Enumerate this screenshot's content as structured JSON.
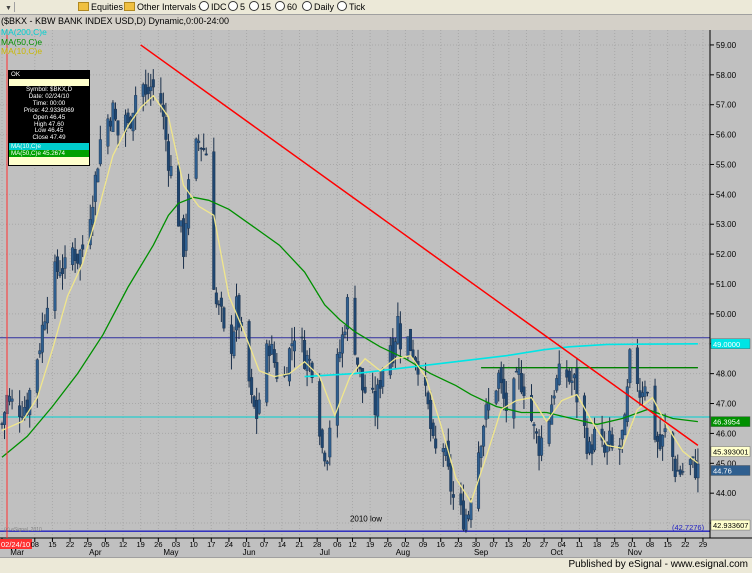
{
  "toolbar": {
    "items": [
      {
        "label": "Equities",
        "icon": "folder-icon"
      },
      {
        "label": "Other Intervals",
        "icon": "folder-icon"
      },
      {
        "label": "IDC",
        "icon": "clock-icon"
      },
      {
        "label": "5",
        "icon": "clock-icon"
      },
      {
        "label": "15",
        "icon": "clock-icon"
      },
      {
        "label": "60",
        "icon": "clock-icon"
      },
      {
        "label": "Daily",
        "icon": "clock-icon"
      },
      {
        "label": "Tick",
        "icon": "clock-icon"
      }
    ]
  },
  "symbol_line": "($BKX - KBW BANK INDEX USD,D) Dynamic,0:00-24:00",
  "ma_labels": {
    "ma200": "MA(200,C)e",
    "ma50": "MA(50,C)e",
    "ma10": "MA(10,C)e"
  },
  "databox": {
    "header": "OK",
    "rows": [
      "Symbol: $BKX,D",
      "Date: 02/24/10",
      "Time: 00:00",
      "Price: 42.9336069",
      "Open 46.45",
      "High 47.60",
      "Low 46.45",
      "Close 47.49"
    ],
    "ma10": "MA(10,C)e",
    "ma50": "MA(50,C)e 45.2674"
  },
  "watermark": "(c) eSignal, 2010",
  "annotation_low": "2010 low",
  "status": "Published by eSignal - www.esignal.com",
  "colors": {
    "background": "#c0c0c0",
    "candle": "#2f5f8f",
    "ma10": "#f0e68c",
    "ma50": "#009000",
    "ma200": "#00e5e5",
    "trendline": "#ff0000",
    "hline_low": "#2020c0",
    "hline_upper": "#3030a0",
    "hline_cyan": "#00d0d0",
    "resistance": "#008000",
    "cursor": "#ff3030"
  },
  "chart_data": {
    "type": "candlestick",
    "ylim": [
      42.5,
      59.5
    ],
    "y_ticks": [
      "59.00",
      "58.00",
      "57.00",
      "56.00",
      "55.00",
      "54.00",
      "53.00",
      "52.00",
      "51.00",
      "50.00",
      "49.00",
      "48.00",
      "47.00",
      "46.00",
      "45.00",
      "44.00",
      "43.00"
    ],
    "x_ticks": [
      {
        "label": "02/24/10",
        "day": 0
      },
      {
        "label": "08",
        "day": 13
      },
      {
        "label": "15",
        "day": 20
      },
      {
        "label": "22",
        "day": 27
      },
      {
        "label": "29",
        "day": 34
      },
      {
        "label": "05",
        "day": 41
      },
      {
        "label": "12",
        "day": 48
      },
      {
        "label": "19",
        "day": 55
      },
      {
        "label": "26",
        "day": 62
      },
      {
        "label": "03",
        "day": 69
      },
      {
        "label": "10",
        "day": 76
      },
      {
        "label": "17",
        "day": 83
      },
      {
        "label": "24",
        "day": 90
      },
      {
        "label": "01",
        "day": 97
      },
      {
        "label": "07",
        "day": 104
      },
      {
        "label": "14",
        "day": 111
      },
      {
        "label": "21",
        "day": 118
      },
      {
        "label": "28",
        "day": 125
      },
      {
        "label": "06",
        "day": 133
      },
      {
        "label": "12",
        "day": 139
      },
      {
        "label": "19",
        "day": 146
      },
      {
        "label": "26",
        "day": 153
      },
      {
        "label": "02",
        "day": 160
      },
      {
        "label": "09",
        "day": 167
      },
      {
        "label": "16",
        "day": 174
      },
      {
        "label": "23",
        "day": 181
      },
      {
        "label": "30",
        "day": 188
      },
      {
        "label": "07",
        "day": 195
      },
      {
        "label": "13",
        "day": 201
      },
      {
        "label": "20",
        "day": 208
      },
      {
        "label": "27",
        "day": 215
      },
      {
        "label": "04",
        "day": 222
      },
      {
        "label": "11",
        "day": 229
      },
      {
        "label": "18",
        "day": 236
      },
      {
        "label": "25",
        "day": 243
      },
      {
        "label": "01",
        "day": 250
      },
      {
        "label": "08",
        "day": 257
      },
      {
        "label": "15",
        "day": 264
      },
      {
        "label": "22",
        "day": 271
      },
      {
        "label": "29",
        "day": 278
      }
    ],
    "month_labels": [
      {
        "label": "Mar",
        "day": 6
      },
      {
        "label": "Apr",
        "day": 37
      },
      {
        "label": "May",
        "day": 67
      },
      {
        "label": "Jun",
        "day": 98
      },
      {
        "label": "Jul",
        "day": 128
      },
      {
        "label": "Aug",
        "day": 159
      },
      {
        "label": "Sep",
        "day": 190
      },
      {
        "label": "Oct",
        "day": 220
      },
      {
        "label": "Nov",
        "day": 251
      }
    ],
    "day_range": [
      0,
      280
    ],
    "close_path": [
      [
        0,
        46.3
      ],
      [
        2,
        47.2
      ],
      [
        6,
        46.8
      ],
      [
        10,
        47.0
      ],
      [
        13,
        48.2
      ],
      [
        15,
        49.0
      ],
      [
        18,
        50.6
      ],
      [
        20,
        51.2
      ],
      [
        23,
        51.6
      ],
      [
        25,
        51.5
      ],
      [
        27,
        52.3
      ],
      [
        30,
        51.9
      ],
      [
        32,
        52.2
      ],
      [
        34,
        53.0
      ],
      [
        37,
        54.5
      ],
      [
        39,
        55.8
      ],
      [
        41,
        56.4
      ],
      [
        44,
        56.8
      ],
      [
        46,
        56.0
      ],
      [
        48,
        57.2
      ],
      [
        50,
        56.2
      ],
      [
        52,
        57.0
      ],
      [
        55,
        58.1
      ],
      [
        57,
        57.2
      ],
      [
        59,
        57.6
      ],
      [
        61,
        57.5
      ],
      [
        63,
        57.1
      ],
      [
        66,
        55.2
      ],
      [
        68,
        54.4
      ],
      [
        70,
        53.2
      ],
      [
        72,
        52.2
      ],
      [
        74,
        54.2
      ],
      [
        76,
        55.2
      ],
      [
        78,
        55.8
      ],
      [
        81,
        55.4
      ],
      [
        83,
        52.0
      ],
      [
        85,
        50.3
      ],
      [
        87,
        49.9
      ],
      [
        89,
        48.6
      ],
      [
        91,
        49.0
      ],
      [
        93,
        50.2
      ],
      [
        95,
        49.3
      ],
      [
        97,
        48.4
      ],
      [
        99,
        47.0
      ],
      [
        101,
        46.6
      ],
      [
        104,
        48.3
      ],
      [
        106,
        49.0
      ],
      [
        108,
        48.4
      ],
      [
        111,
        47.4
      ],
      [
        113,
        48.4
      ],
      [
        116,
        49.4
      ],
      [
        118,
        49.2
      ],
      [
        120,
        48.6
      ],
      [
        123,
        48.3
      ],
      [
        125,
        47.1
      ],
      [
        127,
        45.5
      ],
      [
        129,
        45.4
      ],
      [
        131,
        47.3
      ],
      [
        133,
        48.3
      ],
      [
        135,
        49.2
      ],
      [
        137,
        50.3
      ],
      [
        139,
        49.6
      ],
      [
        141,
        48.4
      ],
      [
        143,
        47.5
      ],
      [
        146,
        47.3
      ],
      [
        148,
        46.8
      ],
      [
        150,
        47.8
      ],
      [
        153,
        49.3
      ],
      [
        155,
        48.8
      ],
      [
        157,
        49.8
      ],
      [
        159,
        48.5
      ],
      [
        161,
        49.1
      ],
      [
        163,
        48.8
      ],
      [
        165,
        48.4
      ],
      [
        167,
        47.6
      ],
      [
        169,
        46.8
      ],
      [
        171,
        45.5
      ],
      [
        173,
        45.2
      ],
      [
        175,
        45.6
      ],
      [
        177,
        44.6
      ],
      [
        179,
        43.8
      ],
      [
        181,
        43.4
      ],
      [
        183,
        43.2
      ],
      [
        185,
        43.4
      ],
      [
        187,
        44.6
      ],
      [
        189,
        45.5
      ],
      [
        191,
        46.4
      ],
      [
        193,
        46.9
      ],
      [
        195,
        47.4
      ],
      [
        197,
        47.9
      ],
      [
        199,
        47.1
      ],
      [
        201,
        46.6
      ],
      [
        203,
        47.4
      ],
      [
        205,
        47.9
      ],
      [
        207,
        47.6
      ],
      [
        209,
        46.8
      ],
      [
        211,
        46.1
      ],
      [
        213,
        45.6
      ],
      [
        215,
        46.0
      ],
      [
        217,
        46.6
      ],
      [
        219,
        47.5
      ],
      [
        221,
        47.9
      ],
      [
        223,
        48.1
      ],
      [
        225,
        47.8
      ],
      [
        227,
        47.7
      ],
      [
        229,
        46.8
      ],
      [
        231,
        46.1
      ],
      [
        233,
        45.4
      ],
      [
        235,
        45.9
      ],
      [
        237,
        45.6
      ],
      [
        239,
        45.3
      ],
      [
        241,
        45.7
      ],
      [
        243,
        45.1
      ],
      [
        245,
        45.6
      ],
      [
        247,
        46.2
      ],
      [
        249,
        48.4
      ],
      [
        251,
        48.3
      ],
      [
        253,
        47.4
      ],
      [
        255,
        47.8
      ],
      [
        257,
        46.7
      ],
      [
        259,
        46.0
      ],
      [
        261,
        45.5
      ],
      [
        263,
        46.0
      ],
      [
        265,
        45.6
      ],
      [
        267,
        44.8
      ],
      [
        269,
        44.7
      ],
      [
        271,
        44.8
      ],
      [
        273,
        45.0
      ],
      [
        276,
        44.76
      ]
    ],
    "ma10": [
      [
        0,
        46.1
      ],
      [
        8,
        46.4
      ],
      [
        14,
        47.2
      ],
      [
        20,
        48.8
      ],
      [
        26,
        50.6
      ],
      [
        32,
        51.7
      ],
      [
        38,
        53.4
      ],
      [
        44,
        55.3
      ],
      [
        50,
        56.3
      ],
      [
        55,
        56.9
      ],
      [
        60,
        57.3
      ],
      [
        66,
        56.6
      ],
      [
        72,
        54.3
      ],
      [
        78,
        53.6
      ],
      [
        84,
        53.3
      ],
      [
        90,
        50.6
      ],
      [
        96,
        49.4
      ],
      [
        102,
        48.1
      ],
      [
        108,
        47.9
      ],
      [
        114,
        48.0
      ],
      [
        120,
        48.4
      ],
      [
        126,
        47.9
      ],
      [
        132,
        46.6
      ],
      [
        138,
        47.9
      ],
      [
        144,
        48.5
      ],
      [
        150,
        48.1
      ],
      [
        156,
        48.5
      ],
      [
        162,
        48.6
      ],
      [
        168,
        47.9
      ],
      [
        174,
        46.3
      ],
      [
        180,
        44.5
      ],
      [
        186,
        43.7
      ],
      [
        192,
        45.2
      ],
      [
        198,
        46.8
      ],
      [
        204,
        47.1
      ],
      [
        210,
        47.2
      ],
      [
        216,
        46.4
      ],
      [
        222,
        47.1
      ],
      [
        228,
        47.3
      ],
      [
        234,
        46.4
      ],
      [
        240,
        45.6
      ],
      [
        246,
        45.5
      ],
      [
        252,
        46.8
      ],
      [
        258,
        47.2
      ],
      [
        264,
        46.2
      ],
      [
        270,
        45.4
      ],
      [
        276,
        45.0
      ]
    ],
    "ma50": [
      [
        0,
        45.2
      ],
      [
        10,
        45.9
      ],
      [
        20,
        46.9
      ],
      [
        30,
        48.0
      ],
      [
        40,
        49.3
      ],
      [
        50,
        50.9
      ],
      [
        60,
        52.3
      ],
      [
        66,
        53.3
      ],
      [
        70,
        53.7
      ],
      [
        76,
        53.9
      ],
      [
        82,
        53.8
      ],
      [
        90,
        53.5
      ],
      [
        100,
        52.9
      ],
      [
        110,
        52.3
      ],
      [
        120,
        51.4
      ],
      [
        128,
        50.3
      ],
      [
        134,
        49.8
      ],
      [
        140,
        49.4
      ],
      [
        150,
        48.9
      ],
      [
        160,
        48.5
      ],
      [
        170,
        48.0
      ],
      [
        180,
        47.6
      ],
      [
        186,
        47.3
      ],
      [
        196,
        46.9
      ],
      [
        206,
        46.7
      ],
      [
        216,
        46.7
      ],
      [
        226,
        46.5
      ],
      [
        236,
        46.3
      ],
      [
        246,
        46.5
      ],
      [
        256,
        46.8
      ],
      [
        266,
        46.5
      ],
      [
        276,
        46.3954
      ]
    ],
    "ma200": [
      [
        120,
        47.9
      ],
      [
        140,
        48.0
      ],
      [
        160,
        48.2
      ],
      [
        180,
        48.4
      ],
      [
        200,
        48.6
      ],
      [
        215,
        48.8
      ],
      [
        225,
        48.9
      ],
      [
        240,
        48.98
      ],
      [
        276,
        49.0
      ]
    ],
    "trendline": [
      [
        55,
        59.0
      ],
      [
        276,
        45.6
      ]
    ],
    "hline_upper": 49.2,
    "hline_cyan": 46.55,
    "hline_low": 42.7276,
    "resistance": [
      [
        190,
        48.2
      ],
      [
        276,
        48.2
      ]
    ],
    "price_labels": [
      {
        "text": "49.0000",
        "value": 49.0,
        "bg": "#00e5e5",
        "fg": "#ffffff"
      },
      {
        "text": "46.3954",
        "value": 46.3954,
        "bg": "#009000",
        "fg": "#ffffff"
      },
      {
        "text": "45.393001",
        "value": 45.393,
        "bg": "#ffffcc",
        "fg": "#000000"
      },
      {
        "text": "44.76",
        "value": 44.76,
        "bg": "#2f5f8f",
        "fg": "#ffffff"
      },
      {
        "text": "42.933607",
        "value": 42.933607,
        "bg": "#ffffcc",
        "fg": "#000000"
      },
      {
        "text": "(42.7276)",
        "value": 42.7276,
        "bg": "none",
        "fg": "#2020c0"
      }
    ],
    "annotations": [
      {
        "text": "2010 low",
        "day": 138,
        "value": 43.05
      }
    ]
  }
}
